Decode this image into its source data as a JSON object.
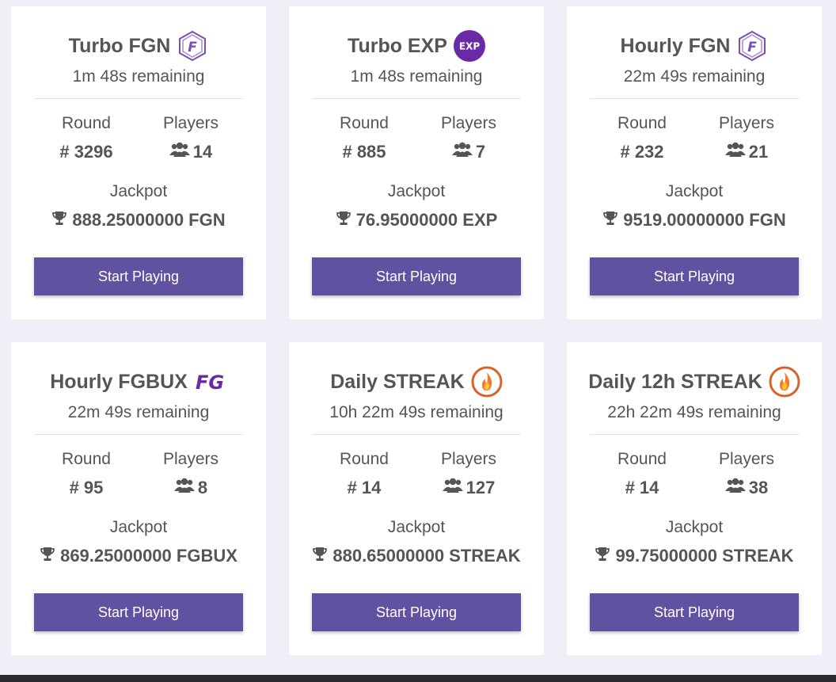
{
  "colors": {
    "page_background": "#efeff7",
    "card_background": "#ffffff",
    "button": "#6052a1",
    "text": "#555555",
    "fgn_icon": "#7b4fb2",
    "exp_badge": "#6a2aa6",
    "streak_icon": "#d9622b"
  },
  "labels": {
    "round": "Round",
    "players": "Players",
    "jackpot": "Jackpot"
  },
  "cards": [
    {
      "title": "Turbo FGN",
      "icon": "fgn-coin-icon",
      "remaining": "1m 48s remaining",
      "round": "# 3296",
      "players": "14",
      "jackpot": "888.25000000 FGN",
      "button": "Start Playing"
    },
    {
      "title": "Turbo EXP",
      "icon": "exp-badge-icon",
      "icon_text": "EXP",
      "remaining": "1m 48s remaining",
      "round": "# 885",
      "players": "7",
      "jackpot": "76.95000000 EXP",
      "button": "Start Playing"
    },
    {
      "title": "Hourly FGN",
      "icon": "fgn-coin-icon",
      "remaining": "22m 49s remaining",
      "round": "# 232",
      "players": "21",
      "jackpot": "9519.00000000 FGN",
      "button": "Start Playing"
    },
    {
      "title": "Hourly FGBUX",
      "icon": "fgbux-logo-icon",
      "remaining": "22m 49s remaining",
      "round": "# 95",
      "players": "8",
      "jackpot": "869.25000000 FGBUX",
      "button": "Start Playing"
    },
    {
      "title": "Daily STREAK",
      "icon": "streak-flame-icon",
      "remaining": "10h 22m 49s remaining",
      "round": "# 14",
      "players": "127",
      "jackpot": "880.65000000 STREAK",
      "button": "Start Playing"
    },
    {
      "title": "Daily 12h STREAK",
      "icon": "streak-flame-icon",
      "remaining": "22h 22m 49s remaining",
      "round": "# 14",
      "players": "38",
      "jackpot": "99.75000000 STREAK",
      "button": "Start Playing"
    }
  ]
}
